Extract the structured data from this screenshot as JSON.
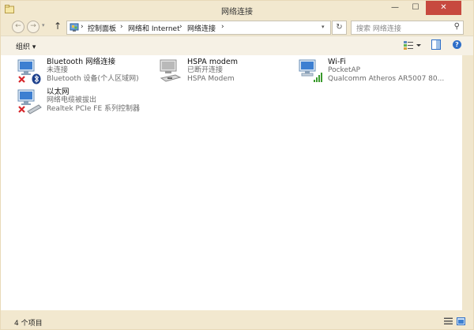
{
  "window": {
    "title": "网络连接",
    "min_glyph": "—",
    "max_glyph": "☐",
    "close_glyph": "✕"
  },
  "nav": {
    "back_glyph": "←",
    "forward_glyph": "→",
    "recent_glyph": "▾",
    "up_glyph": "↑"
  },
  "address": {
    "crumbs": [
      {
        "sep": "›",
        "label": "控制面板"
      },
      {
        "sep": "›",
        "label": "网络和 Internet"
      },
      {
        "sep": "›",
        "label": "网络连接"
      }
    ],
    "trailing_sep": "›",
    "dropdown_glyph": "▾",
    "refresh_glyph": "↻"
  },
  "search": {
    "placeholder": "搜索 网络连接",
    "icon_glyph": "⚲"
  },
  "toolbar": {
    "organize_label": "组织 ▾",
    "help_glyph": "?"
  },
  "connections": [
    {
      "name": "Bluetooth 网络连接",
      "status": "未连接",
      "device": "Bluetooth 设备(个人区域网)",
      "icon": "bluetooth-adapter-icon",
      "badge": "disconnected"
    },
    {
      "name": "HSPA modem",
      "status": "已断开连接",
      "device": "HSPA Modem",
      "icon": "modem-icon",
      "badge": "none"
    },
    {
      "name": "Wi-Fi",
      "status": "PocketAP",
      "device": "Qualcomm Atheros AR5007 80...",
      "icon": "wifi-adapter-icon",
      "badge": "signal"
    },
    {
      "name": "以太网",
      "status": "网络电缆被拔出",
      "device": "Realtek PCIe FE 系列控制器",
      "icon": "ethernet-adapter-icon",
      "badge": "disconnected"
    }
  ],
  "status_bar": {
    "item_count": "4 个项目"
  },
  "colors": {
    "window_frame": "#f0e6cd",
    "close_red": "#c7493f",
    "error_red": "#d7262b",
    "signal_green": "#3a9a2c",
    "help_blue": "#2f6fc8"
  }
}
